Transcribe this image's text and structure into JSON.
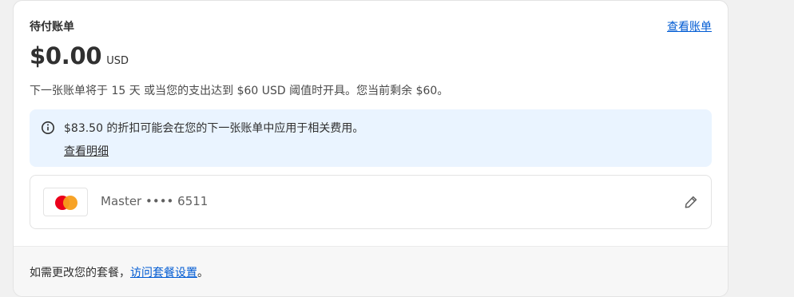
{
  "bill": {
    "title": "待付账单",
    "view_bill_link": "查看账单",
    "amount": "$0.00 USD",
    "amount_unit": "USD",
    "description": "下一张账单将于 15 天 或当您的支出达到 $60 USD 阈值时开具。您当前剩余 $60。"
  },
  "info_banner": {
    "icon": "info-icon",
    "text": "$83.50 的折扣可能会在您的下一张账单中应用于相关费用。",
    "link": "查看明细"
  },
  "payment_method": {
    "brand_icon": "mastercard-logo",
    "card_label": "Master •••• 6511",
    "edit_icon": "pencil-icon"
  },
  "footer": {
    "text_before": "如需更改您的套餐，",
    "link": "访问套餐设置",
    "text_after": "。"
  },
  "colors": {
    "link": "#005bd3",
    "banner_bg": "#eaf4ff",
    "mastercard_red": "#eb001b",
    "mastercard_orange": "#f79e1b"
  }
}
